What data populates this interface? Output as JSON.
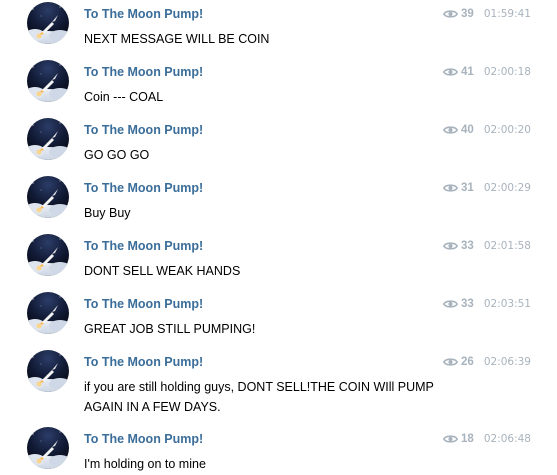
{
  "messages": [
    {
      "sender": "To The Moon Pump!",
      "views": "39",
      "time": "01:59:41",
      "text": "NEXT MESSAGE WILL BE COIN"
    },
    {
      "sender": "To The Moon Pump!",
      "views": "41",
      "time": "02:00:18",
      "text": "Coin --- COAL"
    },
    {
      "sender": "To The Moon Pump!",
      "views": "40",
      "time": "02:00:20",
      "text": "GO GO GO"
    },
    {
      "sender": "To The Moon Pump!",
      "views": "31",
      "time": "02:00:29",
      "text": "Buy Buy"
    },
    {
      "sender": "To The Moon Pump!",
      "views": "33",
      "time": "02:01:58",
      "text": "DONT SELL WEAK HANDS"
    },
    {
      "sender": "To The Moon Pump!",
      "views": "33",
      "time": "02:03:51",
      "text": "GREAT JOB STILL PUMPING!"
    },
    {
      "sender": "To The Moon Pump!",
      "views": "26",
      "time": "02:06:39",
      "text": "if you are still holding guys, DONT SELL!THE COIN WIll PUMP\nAGAIN IN A FEW DAYS."
    },
    {
      "sender": "To The Moon Pump!",
      "views": "18",
      "time": "02:06:48",
      "text": "I'm holding on to mine"
    }
  ],
  "icons": {
    "avatar": "rocket-launch-avatar",
    "views": "eye-icon"
  },
  "colors": {
    "sender": "#3a6d99",
    "meta": "#a8b3bd",
    "text": "#000000"
  }
}
